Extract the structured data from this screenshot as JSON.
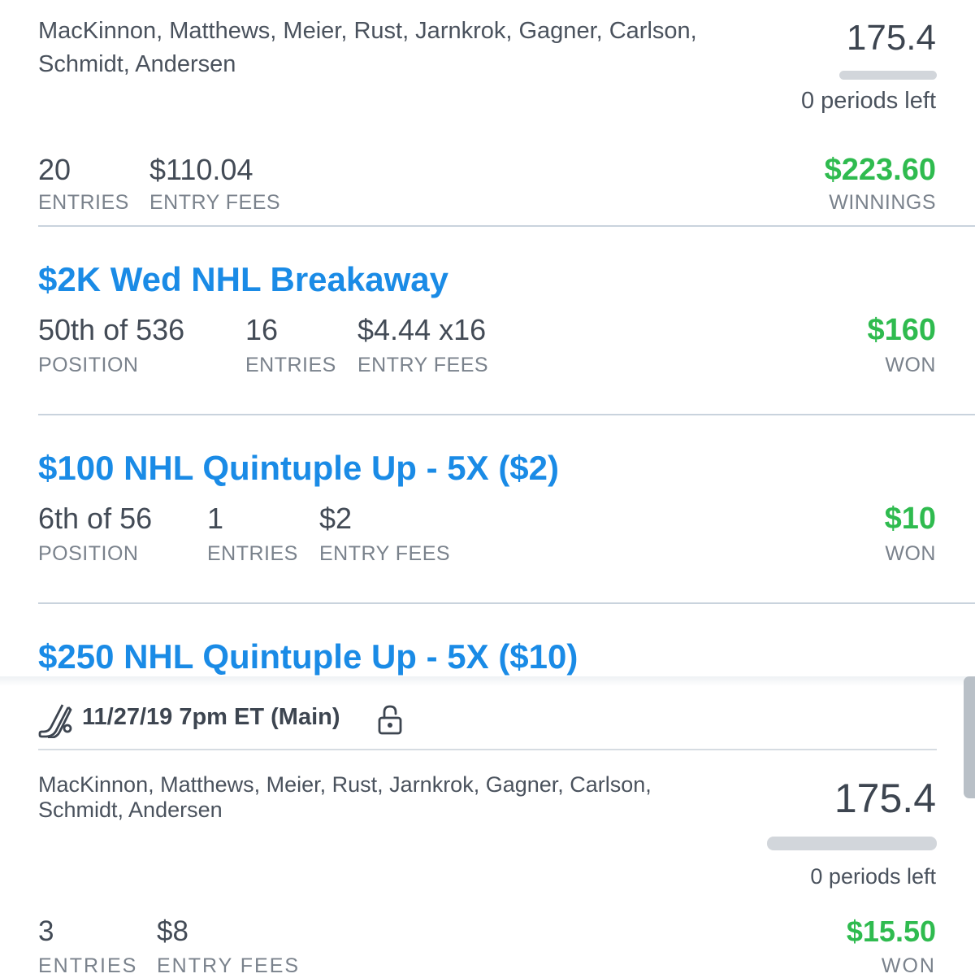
{
  "top_lineup": {
    "players": "MacKinnon, Matthews, Meier, Rust, Jarnkrok, Gagner, Carlson, Schmidt, Andersen",
    "score": "175.4",
    "periods_left": "0 periods left",
    "progress": 0,
    "entries_value": "20",
    "entries_label": "ENTRIES",
    "fees_value": "$110.04",
    "fees_label": "ENTRY FEES",
    "winnings_value": "$223.60",
    "winnings_label": "WINNINGS"
  },
  "contests": [
    {
      "title": "$2K Wed NHL Breakaway",
      "position_value": "50th of 536",
      "position_label": "POSITION",
      "entries_value": "16",
      "entries_label": "ENTRIES",
      "fees_value": "$4.44 x16",
      "fees_label": "ENTRY FEES",
      "won_value": "$160",
      "won_label": "WON"
    },
    {
      "title": "$100 NHL Quintuple Up - 5X ($2)",
      "position_value": "6th of 56",
      "position_label": "POSITION",
      "entries_value": "1",
      "entries_label": "ENTRIES",
      "fees_value": "$2",
      "fees_label": "ENTRY FEES",
      "won_value": "$10",
      "won_label": "WON"
    },
    {
      "title": "$250 NHL Quintuple Up - 5X ($10)"
    }
  ],
  "second_card": {
    "header": "11/27/19 7pm ET (Main)",
    "players": "MacKinnon, Matthews, Meier, Rust, Jarnkrok, Gagner, Carlson, Schmidt, Andersen",
    "score": "175.4",
    "periods_left": "0 periods left",
    "progress": 0,
    "entries_value": "3",
    "entries_label": "ENTRIES",
    "fees_value": "$8",
    "fees_label": "ENTRY FEES",
    "won_value": "$15.50",
    "won_label": "WON"
  },
  "icons": {
    "sport": "hockey-stick-icon",
    "lock": "unlock-icon"
  },
  "colors": {
    "accent_blue": "#1a8be6",
    "win_green": "#2fbb4f",
    "text": "#444c57",
    "label": "#7a828c"
  }
}
